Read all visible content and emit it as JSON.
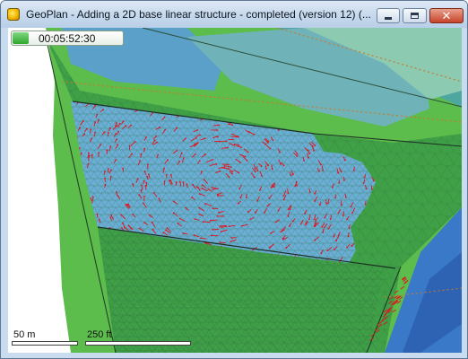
{
  "window": {
    "title": "GeoPlan - Adding a 2D base linear structure - completed (version 12) (...",
    "icon": "geoplan-app-icon",
    "controls": {
      "minimize_icon": "minimize-icon",
      "maximize_icon": "maximize-icon",
      "close_icon": "close-icon",
      "close_glyph": "✕"
    }
  },
  "map": {
    "progress": {
      "time_label": "00:05:52:30",
      "fraction": 0.15
    },
    "scale_bars": [
      {
        "label": "50 m"
      },
      {
        "label": "250 ft"
      }
    ],
    "colors": {
      "mesh_green": "#3fa047",
      "flood_blue": "#6aaed6",
      "velocity_arrows": "#e3121b",
      "background_green": "#5cbc4c",
      "deep_water": "#3a78c8"
    }
  }
}
